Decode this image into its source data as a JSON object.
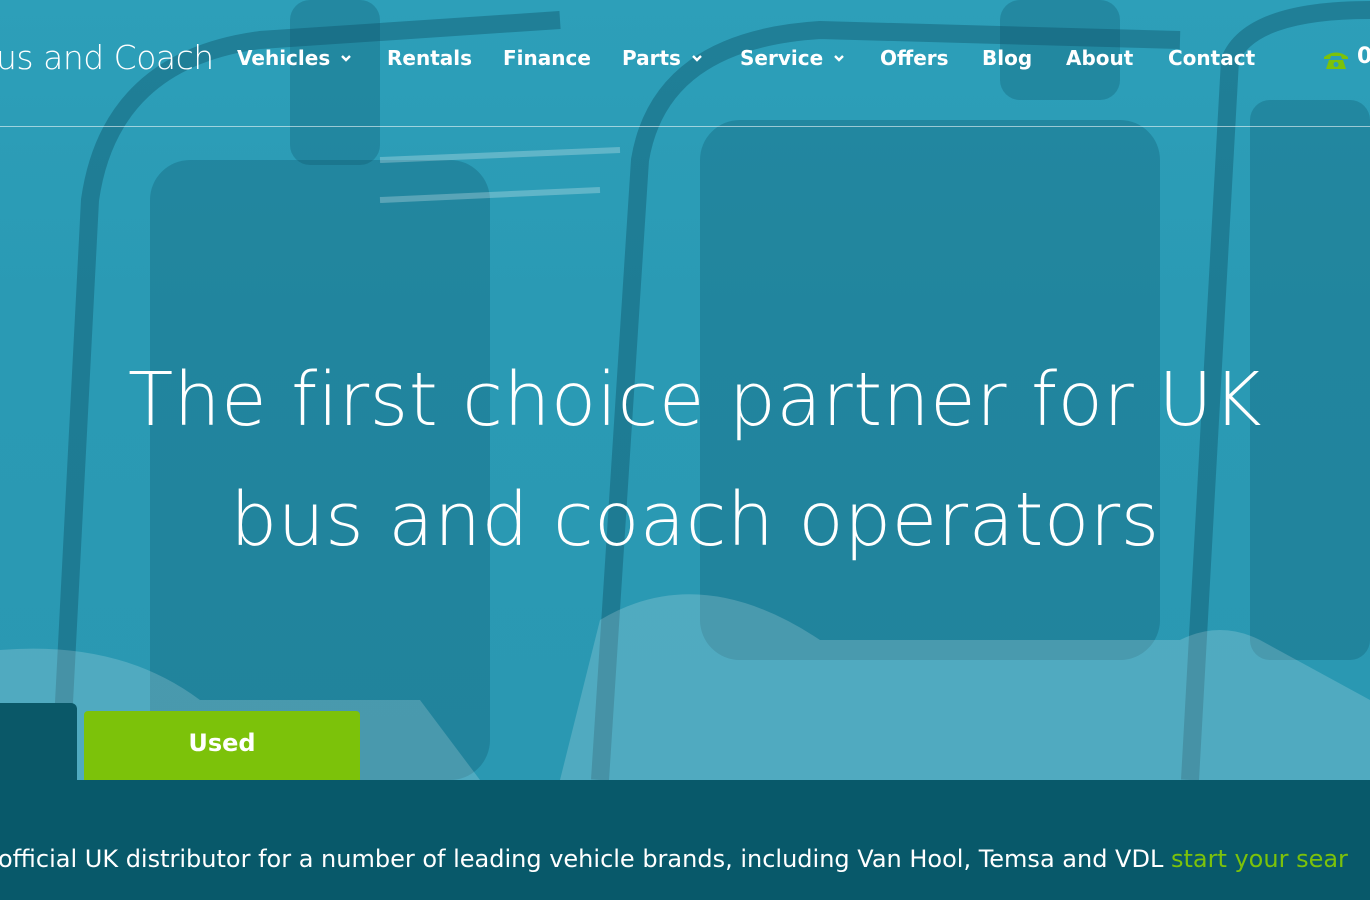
{
  "header": {
    "brand": "us and Coach",
    "nav": [
      {
        "label": "Vehicles",
        "dropdown": true
      },
      {
        "label": "Rentals",
        "dropdown": false
      },
      {
        "label": "Finance",
        "dropdown": false
      },
      {
        "label": "Parts",
        "dropdown": true
      },
      {
        "label": "Service",
        "dropdown": true
      },
      {
        "label": "Offers",
        "dropdown": false
      },
      {
        "label": "Blog",
        "dropdown": false
      },
      {
        "label": "About",
        "dropdown": false
      },
      {
        "label": "Contact",
        "dropdown": false
      }
    ],
    "phone_icon": "phone-icon",
    "phone_text": "0"
  },
  "hero": {
    "headline_line1": "The first choice partner for UK",
    "headline_line2": "bus and coach operators"
  },
  "tabs": {
    "used_label": "Used"
  },
  "band": {
    "text": "official UK distributor for a number of leading vehicle brands, including Van Hool, Temsa and VDL ",
    "link": "start your sear"
  },
  "colors": {
    "hero_teal": "#2d9fb9",
    "dark_teal": "#08596a",
    "accent_green": "#7cc20a"
  }
}
